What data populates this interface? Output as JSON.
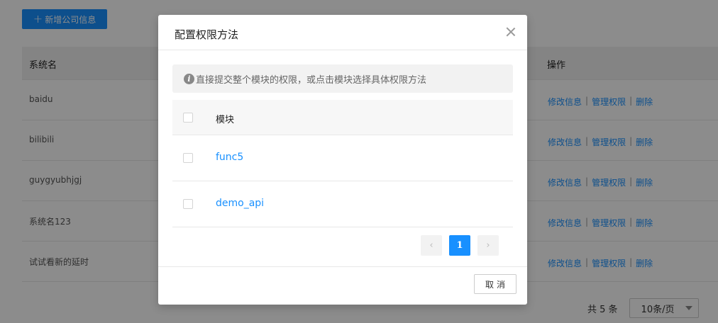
{
  "toolbar": {
    "add_label": "新增公司信息",
    "add_icon": "plus-icon"
  },
  "table": {
    "headers": {
      "name": "系统名",
      "operations": "操作"
    },
    "rows": [
      {
        "name": "baidu",
        "edit": "修改信息",
        "manage": "管理权限",
        "delete": "删除"
      },
      {
        "name": "bilibili",
        "edit": "修改信息",
        "manage": "管理权限",
        "delete": "删除"
      },
      {
        "name": "guygyubhjgj",
        "edit": "修改信息",
        "manage": "管理权限",
        "delete": "删除"
      },
      {
        "name": "系统名123",
        "edit": "修改信息",
        "manage": "管理权限",
        "delete": "删除"
      },
      {
        "name": "试试看新的延时",
        "edit": "修改信息",
        "manage": "管理权限",
        "delete": "删除"
      }
    ],
    "separator": "|"
  },
  "pagination": {
    "total": "共 5 条",
    "page_size": "10条/页"
  },
  "modal": {
    "title": "配置权限方法",
    "info": "直接提交整个模块的权限，或点击模块选择具体权限方法",
    "info_icon": "info-icon",
    "column_header": "模块",
    "modules": [
      "func5",
      "demo_api"
    ],
    "pager": {
      "prev": "‹",
      "current": "1",
      "next": "›"
    },
    "cancel_label": "取消"
  },
  "colors": {
    "primary": "#1890ff",
    "mask": "rgba(0,0,0,0.45)"
  }
}
